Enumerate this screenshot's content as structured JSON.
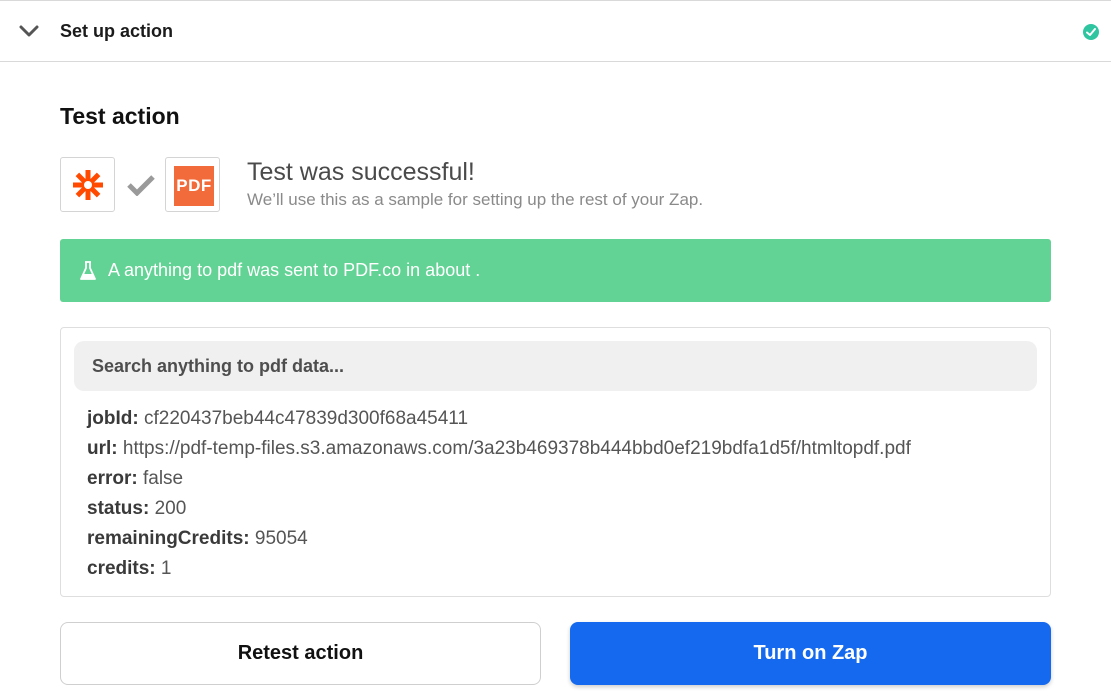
{
  "header": {
    "title": "Set up action",
    "collapse_icon": "chevron-down-icon",
    "status_icon": "check-circle-icon",
    "status_color": "#2fc5a0"
  },
  "test_section": {
    "title": "Test action",
    "apps": [
      {
        "name": "Zapier",
        "icon": "zapier-asterisk-icon",
        "color": "#ff4a00"
      },
      {
        "name": "PDF.co",
        "icon_text": "PDF",
        "color": "#f26b3a"
      }
    ],
    "connector_icon": "check-icon",
    "success_title": "Test was successful!",
    "success_subtitle": "We’ll use this as a sample for setting up the rest of your Zap."
  },
  "banner": {
    "icon": "flask-icon",
    "text": "A anything to pdf was sent to PDF.co in about .",
    "color": "#62d394"
  },
  "data_panel": {
    "search_placeholder": "Search anything to pdf data...",
    "fields": [
      {
        "key": "jobId:",
        "value": "cf220437beb44c47839d300f68a45411"
      },
      {
        "key": "url:",
        "value": "https://pdf-temp-files.s3.amazonaws.com/3a23b469378b444bbd0ef219bdfa1d5f/htmltopdf.pdf"
      },
      {
        "key": "error:",
        "value": "false"
      },
      {
        "key": "status:",
        "value": "200"
      },
      {
        "key": "remainingCredits:",
        "value": "95054"
      },
      {
        "key": "credits:",
        "value": "1"
      }
    ]
  },
  "actions": {
    "retest_label": "Retest action",
    "turn_on_label": "Turn on Zap",
    "primary_color": "#1469ef"
  }
}
